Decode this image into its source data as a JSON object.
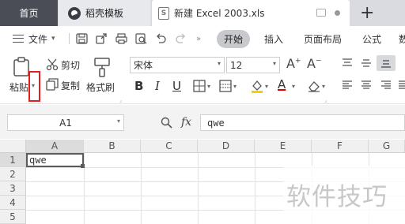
{
  "tabs": {
    "home": "首页",
    "docer": "稻壳模板",
    "document": "新建 Excel 2003.xls",
    "doc_icon_letter": "S"
  },
  "menubar": {
    "file_label": "文件",
    "tabs": [
      "开始",
      "插入",
      "页面布局",
      "公式",
      "数"
    ],
    "active_tab": "开始"
  },
  "ribbon": {
    "paste_label": "粘贴",
    "cut_label": "剪切",
    "copy_label": "复制",
    "format_painter_label": "格式刷",
    "font_name": "宋体",
    "font_size": "12",
    "bold": "B",
    "italic": "I",
    "underline": "U",
    "font_color_letter": "A",
    "grow_font": "A⁺",
    "shrink_font": "A⁻"
  },
  "formula_bar": {
    "name_box": "A1",
    "fx_label": "fx",
    "formula_value": "qwe"
  },
  "sheet": {
    "columns": [
      "A",
      "B",
      "C",
      "D",
      "E",
      "F",
      "G"
    ],
    "rows": [
      "1",
      "2",
      "3",
      "4",
      "5"
    ],
    "a1_value": "qwe",
    "selected_cell": "A1"
  },
  "watermark": "软件技巧",
  "colors": {
    "tabbar_bg": "#d9dbe0",
    "home_tab_bg": "#4a4d55",
    "active_pill_bg": "#c7c9cd",
    "highlight_box": "#e02020"
  }
}
